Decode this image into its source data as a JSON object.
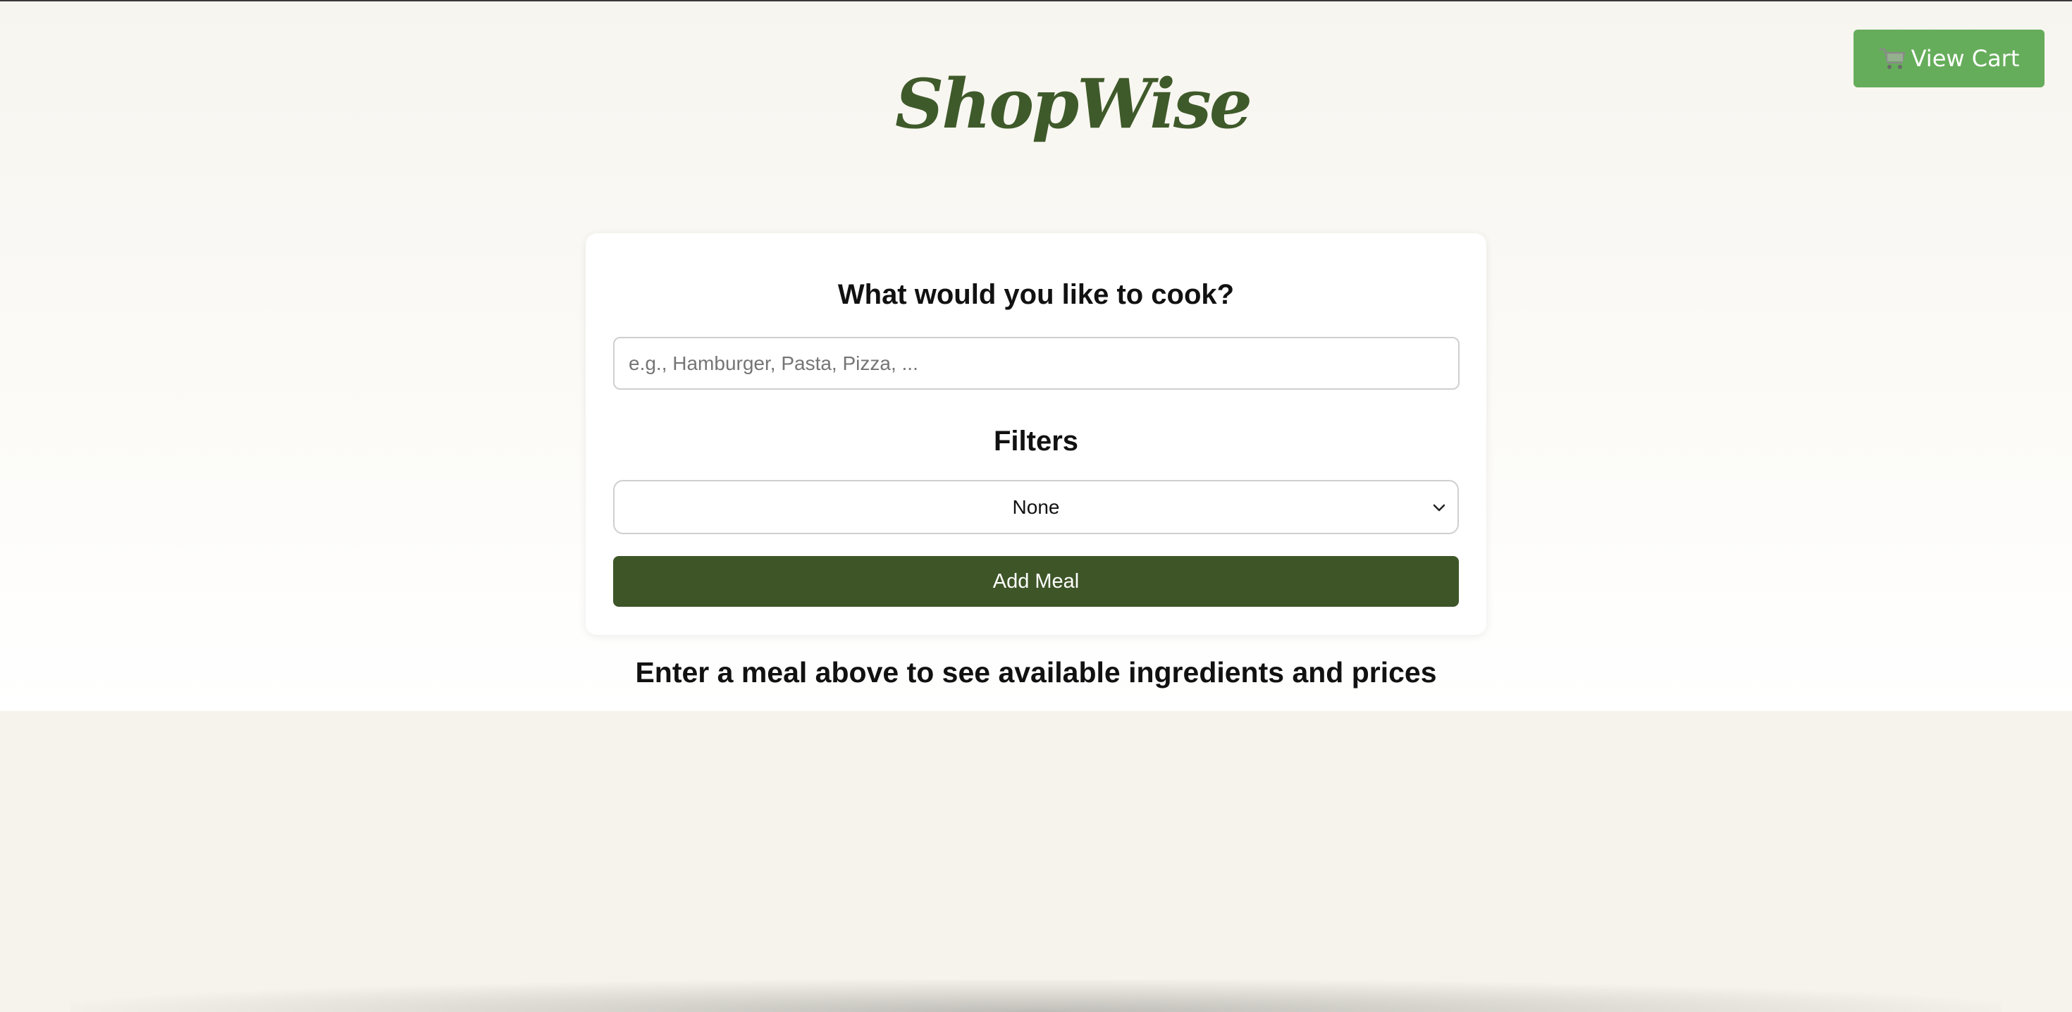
{
  "header": {
    "logo_text": "ShopWise",
    "cart_button_label": "View Cart",
    "cart_icon": "cart-icon"
  },
  "search_card": {
    "title": "What would you like to cook?",
    "meal_input": {
      "value": "",
      "placeholder": "e.g., Hamburger, Pasta, Pizza, ..."
    },
    "filters_title": "Filters",
    "filter_select": {
      "selected": "None"
    },
    "add_button_label": "Add Meal"
  },
  "hint_text": "Enter a meal above to see available ingredients and prices",
  "colors": {
    "brand_green": "#3f5a2a",
    "cart_button_green": "#66ad5b",
    "add_button_green": "#3e5528",
    "page_background": "#f6f4ee"
  }
}
